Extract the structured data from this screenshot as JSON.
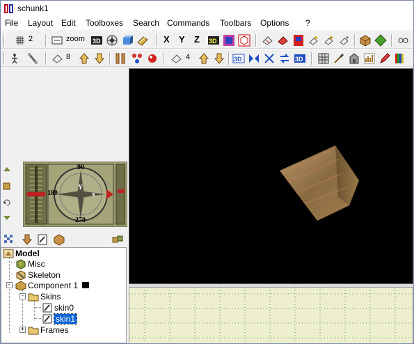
{
  "window": {
    "title": "schunk1"
  },
  "menu": [
    "File",
    "Layout",
    "Edit",
    "Toolboxes",
    "Search",
    "Commands",
    "Toolbars",
    "Options",
    "?"
  ],
  "toolbar1": {
    "grid_value": "2",
    "zoom_label": "zoom",
    "axes": [
      "X",
      "Y",
      "Z"
    ]
  },
  "toolbar2": {
    "count_a": "8",
    "count_b": "4"
  },
  "compass": {
    "north": "90",
    "west": "180",
    "south": "270",
    "y_axis": "Y",
    "x_axis": "x"
  },
  "tree": {
    "root": "Model",
    "misc": "Misc",
    "skeleton": "Skeleton",
    "component": "Component 1",
    "skins": "Skins",
    "skin0": "skin0",
    "skin1": "skin1",
    "frames": "Frames"
  },
  "colors": {
    "viewport_3d_bg": "#000000",
    "viewport_2d_bg": "#eeeed0",
    "selection": "#0a64d6",
    "model_tan": "#9a7a48"
  }
}
